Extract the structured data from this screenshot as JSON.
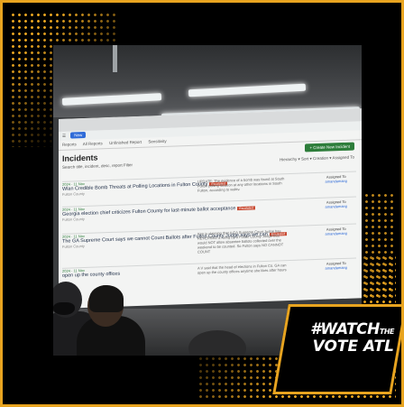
{
  "screen": {
    "nav_new_label": "New",
    "tabs": [
      "Reports",
      "All Reports",
      "Unfinished Report",
      "Sensitivity"
    ],
    "page_title": "Incidents",
    "create_button": "+ Create New Incident",
    "toolbar_left": "Search title, incident, desc, report   Filter",
    "toolbar_right": "Hierarchy  ▾ Sort  ▾ Creation  ▾ Assigned To",
    "rows": [
      {
        "date": "2024 · 11 Nov",
        "title": "Wlan Credible Bomb Threats at Polling Locations in Fulton County",
        "tag": "Escalated",
        "desc": "UPDATE: The evidence of a bomb was found at South Fulton polling location at any other locations in South Fulton, according to wsbtv.",
        "assigned_label": "Assigned To",
        "assigned_name": "amandamang",
        "meta": "Fulton County"
      },
      {
        "date": "2024 · 11 Nov",
        "title": "Georgia election chief criticizes Fulton County for last-minute ballot acceptance",
        "tag": "Escalated",
        "desc": "",
        "assigned_label": "Assigned To",
        "assigned_name": "amandamang",
        "meta": "Fulton County"
      },
      {
        "date": "2024 · 11 Nov",
        "title": "The GA Supreme Court says we cannot Count Ballots after Fulton County Judge says we can",
        "tag": "Escalated",
        "desc": "Ken is claiming that A GA Supreme Court Judge has REVERSED a ruling by a Fulton County Judge that would NOT allow absentee ballots collected over the weekend to be counted. So Fulton says NO CANNOT COUNT",
        "assigned_label": "Assigned To",
        "assigned_name": "amandamang",
        "meta": "Fulton County"
      },
      {
        "date": "2024 · 11 Nov",
        "title": "open up the county offices",
        "tag": "",
        "desc": "A V said that the head of elections in Fulton Co. GA can open up the county offices anytime she likes after hours",
        "assigned_label": "Assigned To",
        "assigned_name": "amandamang",
        "meta": ""
      }
    ]
  },
  "logo": {
    "line1": "#WATCH",
    "line1_small": "THE",
    "line2": "VOTE ATL"
  },
  "colors": {
    "accent": "#e8a420",
    "create_green": "#2d7d3a",
    "tag_red": "#c94a32"
  }
}
